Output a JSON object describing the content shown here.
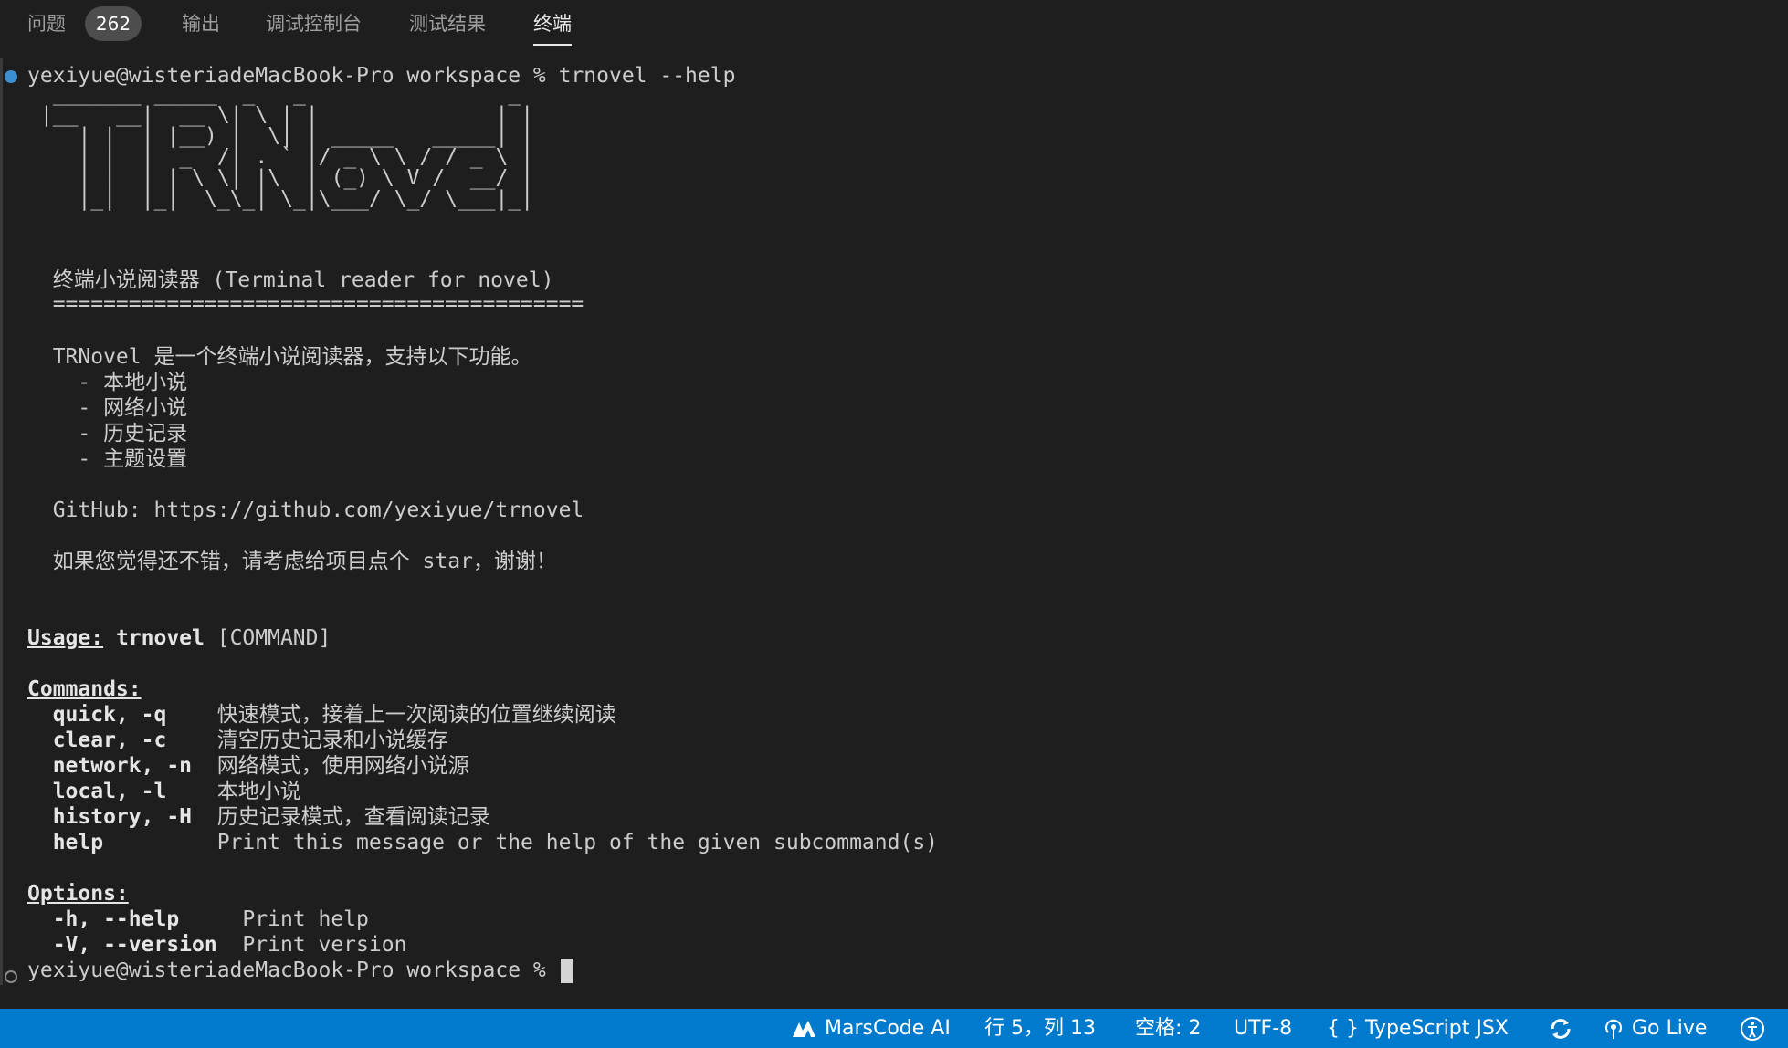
{
  "panel_tabs": {
    "problems": "问题",
    "problems_count": "262",
    "output": "输出",
    "debug_console": "调试控制台",
    "test_results": "测试结果",
    "terminal": "终端"
  },
  "terminal": {
    "prompt": "yexiyue@wisteriadeMacBook-Pro workspace %",
    "command": " trnovel --help",
    "ascii_art": " _______ _____  _   _                _ \n|__   __|  __ \\| \\ | |              | |\n   | |  | |__) |  \\| | _____   _____| |\n   | |  |  _  /| . ` |/ _ \\ \\ / / _ \\ |\n   | |  | | \\ \\| |\\  | (_) \\ V /  __/ |\n   |_|  |_|  \\_\\_| \\_|\\___/ \\_/ \\___|_|",
    "subtitle": "  终端小说阅读器 (Terminal reader for novel)",
    "separator": "  ==========================================",
    "intro": "  TRNovel 是一个终端小说阅读器，支持以下功能。",
    "features": [
      "    - 本地小说",
      "    - 网络小说",
      "    - 历史记录",
      "    - 主题设置"
    ],
    "github": "  GitHub: https://github.com/yexiyue/trnovel",
    "star": "  如果您觉得还不错，请考虑给项目点个 star，谢谢！",
    "usage_label": "Usage:",
    "usage_cmd": " trnovel",
    "usage_args": " [COMMAND]",
    "commands_label": "Commands:",
    "commands": [
      {
        "name": "  quick, -q    ",
        "desc": "快速模式，接着上一次阅读的位置继续阅读"
      },
      {
        "name": "  clear, -c    ",
        "desc": "清空历史记录和小说缓存"
      },
      {
        "name": "  network, -n  ",
        "desc": "网络模式，使用网络小说源"
      },
      {
        "name": "  local, -l    ",
        "desc": "本地小说"
      },
      {
        "name": "  history, -H  ",
        "desc": "历史记录模式，查看阅读记录"
      },
      {
        "name": "  help         ",
        "desc": "Print this message or the help of the given subcommand(s)"
      }
    ],
    "options_label": "Options:",
    "options": [
      {
        "name": "  -h, --help     ",
        "desc": "Print help"
      },
      {
        "name": "  -V, --version  ",
        "desc": "Print version"
      }
    ],
    "final_prompt": "yexiyue@wisteriadeMacBook-Pro workspace % "
  },
  "status_bar": {
    "marscode": "MarsCode AI",
    "position": "行 5，列 13",
    "spaces": "空格: 2",
    "encoding": "UTF-8",
    "language_braces": "{ }",
    "language": "TypeScript JSX",
    "go_live": "Go Live",
    "accent_color": "#007acc"
  },
  "icons": [
    "marscode-logo-icon",
    "sync-icon",
    "broadcast-icon",
    "accessibility-icon"
  ]
}
